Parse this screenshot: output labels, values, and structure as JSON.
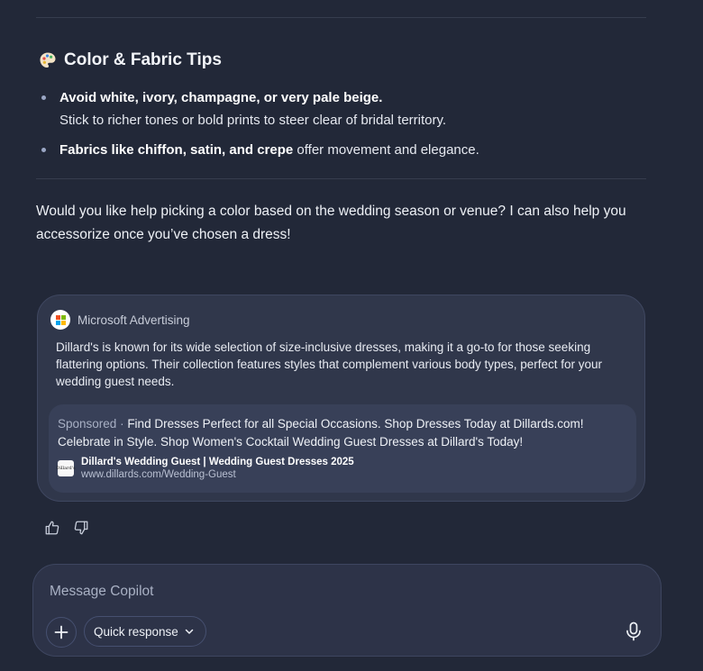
{
  "section": {
    "icon": "palette-icon",
    "title": "Color & Fabric Tips"
  },
  "bullets": [
    {
      "bold": "Avoid white, ivory, champagne, or very pale beige.",
      "text": "Stick to richer tones or bold prints to steer clear of bridal territory."
    },
    {
      "bold": "Fabrics like chiffon, satin, and crepe",
      "text": " offer movement and elegance."
    }
  ],
  "closing": "Would you like help picking a color based on the wedding season or venue? I can also help you accessorize once you’ve chosen a dress!",
  "ad": {
    "source": "Microsoft Advertising",
    "description": "Dillard's is known for its wide selection of size-inclusive dresses, making it a go-to for those seeking flattering options. Their collection features styles that complement various body types, perfect for your wedding guest needs.",
    "sponsored_label": "Sponsored",
    "sponsored_text": "Find Dresses Perfect for all Special Occasions. Shop Dresses Today at Dillards.com! Celebrate in Style. Shop Women's Cocktail Wedding Guest Dresses at Dillard's Today!",
    "link_title": "Dillard's Wedding Guest | Wedding Guest Dresses 2025",
    "link_url": "www.dillards.com/Wedding-Guest",
    "favicon_text": "Dillard's"
  },
  "feedback": {
    "like_icon": "thumbs-up-icon",
    "dislike_icon": "thumbs-down-icon"
  },
  "composer": {
    "placeholder": "Message Copilot",
    "quick_response_label": "Quick response",
    "plus_icon": "plus-icon",
    "mic_icon": "microphone-icon"
  },
  "colors": {
    "background": "#222838",
    "card": "#30374b",
    "sponsor_box": "#384058",
    "composer": "#2d3348"
  }
}
